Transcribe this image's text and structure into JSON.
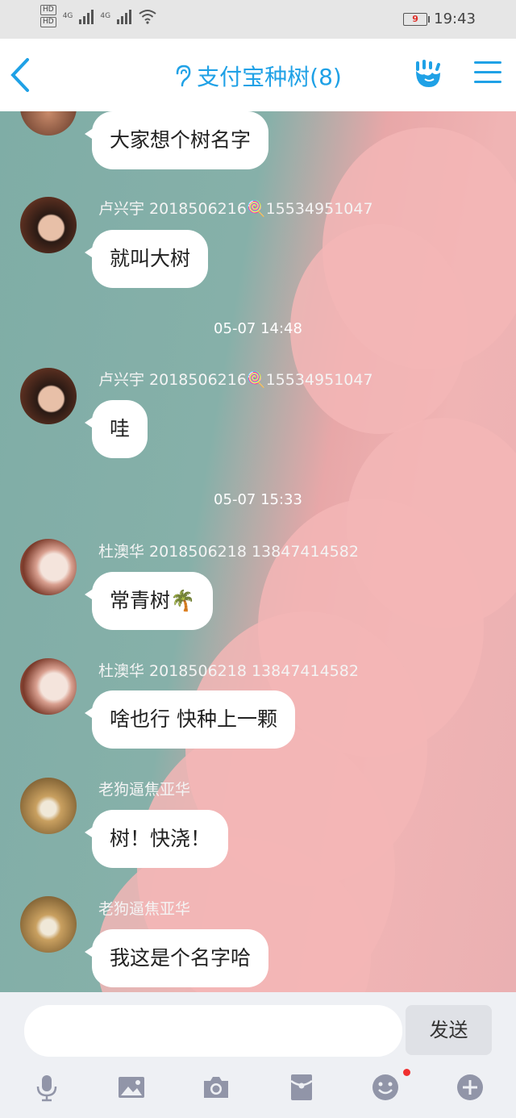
{
  "status_bar": {
    "hd1": "HD",
    "hd2": "HD",
    "net1": "4G",
    "net2": "4G",
    "battery": "9",
    "time": "19:43"
  },
  "header": {
    "title": "支付宝种树(8)"
  },
  "colors": {
    "accent": "#1fa1e6",
    "red_dot": "#f03030"
  },
  "messages": [
    {
      "text": "大家想个树名字"
    },
    {
      "sender": "卢兴宇 2018506216🍭15534951047",
      "text": "就叫大树"
    },
    {
      "time": "05-07 14:48"
    },
    {
      "sender": "卢兴宇 2018506216🍭15534951047",
      "text": "哇"
    },
    {
      "time": "05-07 15:33"
    },
    {
      "sender": "杜澳华 2018506218  13847414582",
      "text": "常青树🌴"
    },
    {
      "sender": "杜澳华 2018506218  13847414582",
      "text": "啥也行 快种上一颗"
    },
    {
      "sender": "老狗逼焦亚华",
      "text": "树！快浇！"
    },
    {
      "sender": "老狗逼焦亚华",
      "text": "我这是个名字哈"
    }
  ],
  "input": {
    "placeholder": "",
    "send_label": "发送"
  },
  "toolbar": {
    "icons": [
      "microphone-icon",
      "image-icon",
      "camera-icon",
      "red-packet-icon",
      "emoji-icon",
      "plus-icon"
    ]
  }
}
